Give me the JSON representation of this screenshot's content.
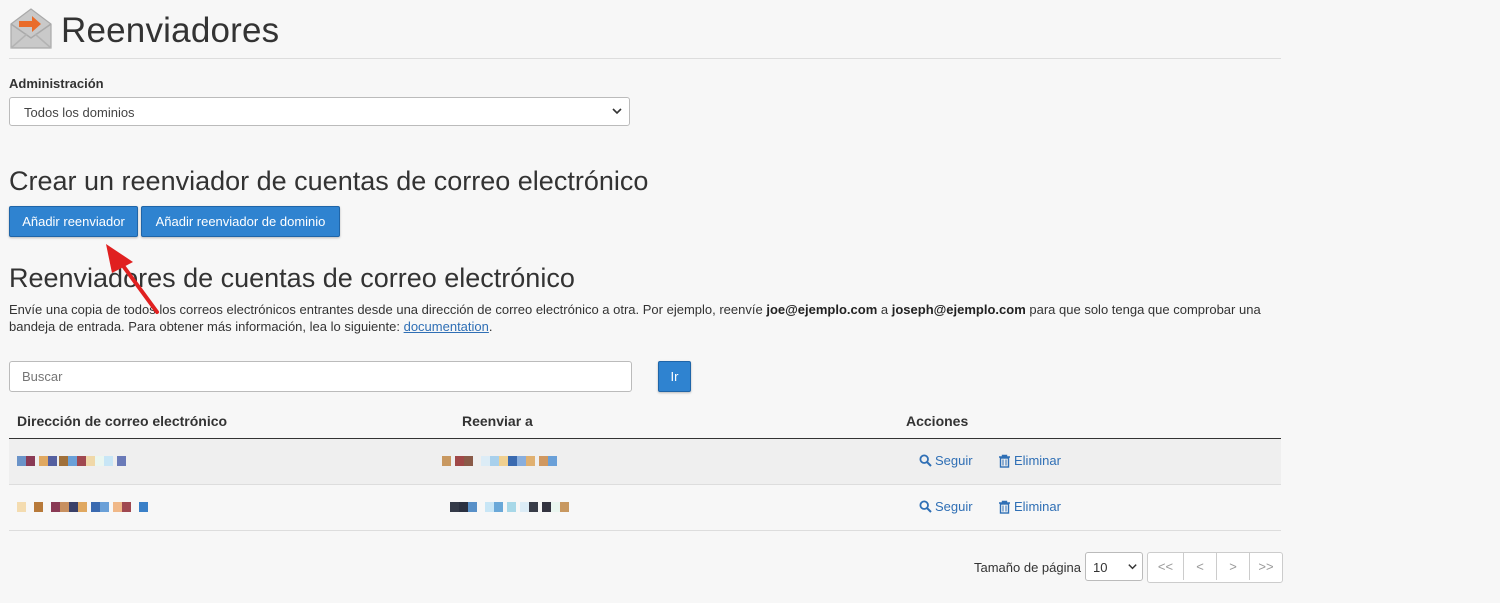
{
  "page": {
    "title": "Reenviadores",
    "icon": "mail-forward-icon"
  },
  "admin": {
    "label": "Administración",
    "select_value": "Todos los dominios"
  },
  "create": {
    "heading": "Crear un reenviador de cuentas de correo electrónico",
    "add_forwarder_label": "Añadir reenviador",
    "add_domain_forwarder_label": "Añadir reenviador de dominio"
  },
  "list": {
    "heading": "Reenviadores de cuentas de correo electrónico",
    "desc_part1": "Envíe una copia de todos los correos electrónicos entrantes desde una dirección de correo electrónico a otra. Por ejemplo, reenvíe ",
    "desc_bold1": "joe@ejemplo.com",
    "desc_part2": " a ",
    "desc_bold2": "joseph@ejemplo.com",
    "desc_part3": " para que solo tenga que comprobar una bandeja de entrada. Para obtener más información, lea lo siguiente: ",
    "desc_link": "documentation",
    "desc_end": "."
  },
  "search": {
    "placeholder": "Buscar",
    "go_label": "Ir"
  },
  "table": {
    "headers": [
      "Dirección de correo electrónico",
      "Reenviar a",
      "Acciones"
    ],
    "rows": [
      {
        "email": "[redacted]",
        "forward_to": "[redacted]",
        "action_follow": "Seguir",
        "action_delete": "Eliminar"
      },
      {
        "email": "[redacted]",
        "forward_to": "[redacted]",
        "action_follow": "Seguir",
        "action_delete": "Eliminar"
      }
    ]
  },
  "pagination": {
    "page_size_label": "Tamaño de página",
    "page_size_value": "10",
    "buttons": [
      "<<",
      "<",
      ">",
      ">>"
    ]
  },
  "colors": {
    "primary_button": "#2f83d0",
    "link": "#2f6fb5",
    "annotation_arrow": "#e02020"
  }
}
